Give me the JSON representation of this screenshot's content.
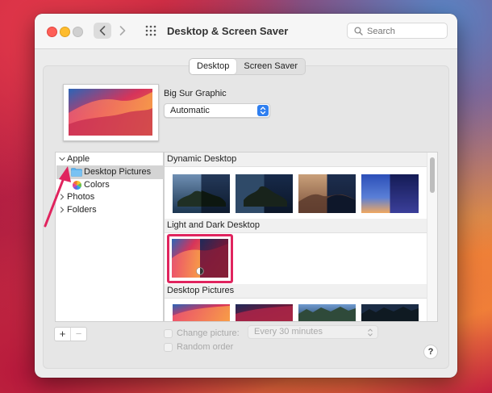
{
  "window": {
    "title": "Desktop & Screen Saver",
    "search_placeholder": "Search"
  },
  "tabs": [
    {
      "label": "Desktop",
      "selected": true
    },
    {
      "label": "Screen Saver",
      "selected": false
    }
  ],
  "current_wallpaper": {
    "name": "Big Sur Graphic",
    "appearance_option": "Automatic"
  },
  "sidebar": {
    "items": [
      {
        "label": "Apple",
        "expanded": true,
        "icon": "chevron-down-icon"
      },
      {
        "label": "Desktop Pictures",
        "selected": true,
        "icon": "folder-icon"
      },
      {
        "label": "Colors",
        "icon": "color-wheel-icon"
      },
      {
        "label": "Photos",
        "expanded": false,
        "icon": "chevron-right-icon"
      },
      {
        "label": "Folders",
        "expanded": false,
        "icon": "chevron-right-icon"
      }
    ]
  },
  "sections": [
    {
      "label": "Dynamic Desktop"
    },
    {
      "label": "Light and Dark Desktop"
    },
    {
      "label": "Desktop Pictures"
    }
  ],
  "options": {
    "change_picture_label": "Change picture:",
    "change_picture_interval": "Every 30 minutes",
    "random_order_label": "Random order"
  },
  "buttons": {
    "add": "+",
    "remove": "−",
    "help": "?"
  },
  "colors": {
    "highlight": "#e0245e",
    "accent": "#2f7ff0"
  }
}
